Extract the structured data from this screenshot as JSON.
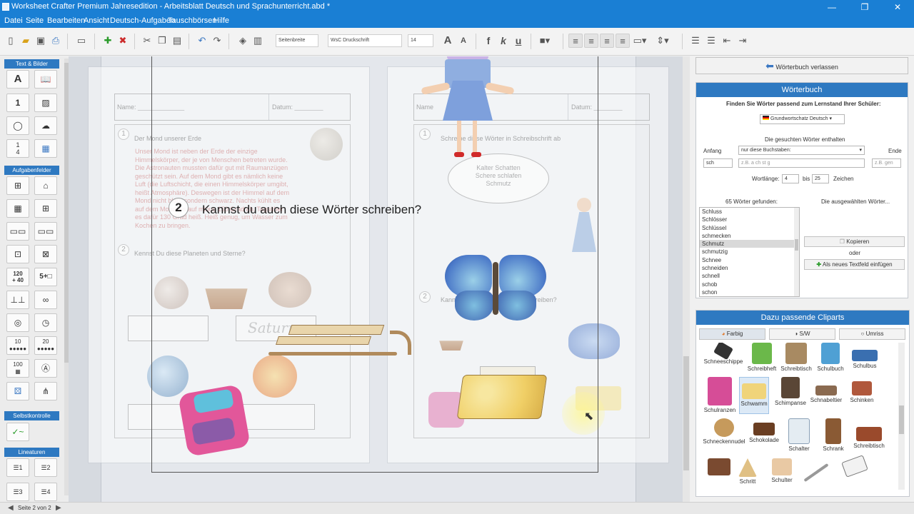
{
  "window": {
    "title": "Worksheet Crafter Premium Jahresedition - Arbeitsblatt Deutsch und Sprachunterricht.abd *",
    "buttons": [
      "—",
      "❐",
      "✕"
    ]
  },
  "menu": [
    "Datei",
    "Seite",
    "Bearbeiten",
    "Ansicht",
    "Deutsch-Aufgaben",
    "Tauschbörsen",
    "Hilfe"
  ],
  "toolbar": {
    "page_width": "Seitenbreite",
    "font": "WsC Druckschrift",
    "font_size": "14",
    "bold": "f",
    "italic": "k",
    "underline": "u",
    "grow_font": "A",
    "shrink_font": "A"
  },
  "left_panel": {
    "sections": [
      "Text & Bilder",
      "Aufgabenfelder",
      "Selbstkontrolle",
      "Lineaturen"
    ],
    "labels": {
      "one": "1",
      "frac_num": "1",
      "frac_den": "4",
      "a_letter": "A",
      "n120": "120",
      "n40": "+ 40",
      "five": "5+□",
      "ten": "10",
      "twenty": "20",
      "n100": "100",
      "ln1": "1",
      "ln2": "2",
      "ln3": "3",
      "ln4": "4"
    }
  },
  "worksheet": {
    "left_page": {
      "name_label": "Name: _____________",
      "date_label": "Datum: ________",
      "task1_num": "1",
      "task1_title": "Der Mond unserer Erde",
      "task1_text": [
        "Unser Mond ist neben der Erde der einzige",
        "Himmelskörper, der je von Menschen betreten wurde.",
        "Die Astronauten mussten dafür gut mit Raumanzügen",
        "geschützt sein. Auf dem Mond gibt es nämlich keine",
        "Luft (die Luftschicht, die einen Himmelskörper umgibt,",
        "heißt Atmosphäre). Deswegen ist der Himmel auf dem",
        "Mond nicht blau, sondern schwarz. Nachts kühlt es",
        "auf dem Mond bis auf minus 150 Grad ab. Tagsüber",
        "es dafür 130 Grad heiß. Heiß genug, um Wasser zum",
        "Kochen zu bringen."
      ],
      "task2_num": "2",
      "task2_title": "Kennst Du diese Planeten und Sterne?",
      "saturn_label": "Saturn"
    },
    "right_page": {
      "name_label": "Name",
      "date_label": "Datum: ________",
      "task1_num": "1",
      "task1_title": "Schreibe diese Wörter in Schreibschrift ab",
      "cloud_text": [
        "Kalter Schatten",
        "Schere schlafen",
        "Schmutz"
      ],
      "task2_num": "2",
      "task2_title": "Kannst du auch diese Wörter schreiben?"
    },
    "overlay_num": "2",
    "overlay_title": "Kannst du auch diese Wörter schreiben?"
  },
  "dictionary": {
    "leave_button": "Wörterbuch verlassen",
    "header": "Wörterbuch",
    "subtitle": "Finden Sie Wörter passend zum Lernstand Ihrer Schüler:",
    "vocab_select": "Grundwortschatz Deutsch",
    "contains_label": "Die gesuchten Wörter enthalten",
    "start_label": "Anfang",
    "end_label": "Ende",
    "start_value": "sch",
    "letters_select": "nur diese Buchstaben:",
    "letters_placeholder": "z.B. a ch st g",
    "end_placeholder": "z.B. gen",
    "word_length_label": "Wortlänge:",
    "len_min": "4",
    "to_label": "bis",
    "len_max": "25",
    "chars_label": "Zeichen",
    "found_label": "65 Wörter gefunden:",
    "selected_label": "Die ausgewählten Wörter...",
    "words": [
      "Schluss",
      "Schlösser",
      "Schlüssel",
      "schmecken",
      "Schmutz",
      "schmutzig",
      "Schnee",
      "schneiden",
      "schnell",
      "schob",
      "schon"
    ],
    "selected_word": "Schmutz",
    "copy_button": "Kopieren",
    "or_label": "oder",
    "insert_button": "Als neues Textfeld einfügen"
  },
  "cliparts": {
    "header": "Dazu passende Cliparts",
    "tabs": [
      "Farbig",
      "S/W",
      "Umriss"
    ],
    "items": [
      "Schneeschippe",
      "Schreibheft",
      "Schreibtisch",
      "Schulbuch",
      "Schulbus",
      "Schulranzen",
      "Schwamm",
      "Schimpanse",
      "Schnabeltier",
      "Schinken",
      "Schneckennudel",
      "Schokolade",
      "Schalter",
      "Schrank",
      "Schreibtisch",
      "",
      "Schritt",
      "Schulter",
      "",
      ""
    ]
  },
  "status": {
    "page_label": "Seite 2 von 2"
  },
  "colors": {
    "accent": "#1a7fd4",
    "panel_header": "#2e79c1",
    "butterfly": "#4a78c8"
  }
}
